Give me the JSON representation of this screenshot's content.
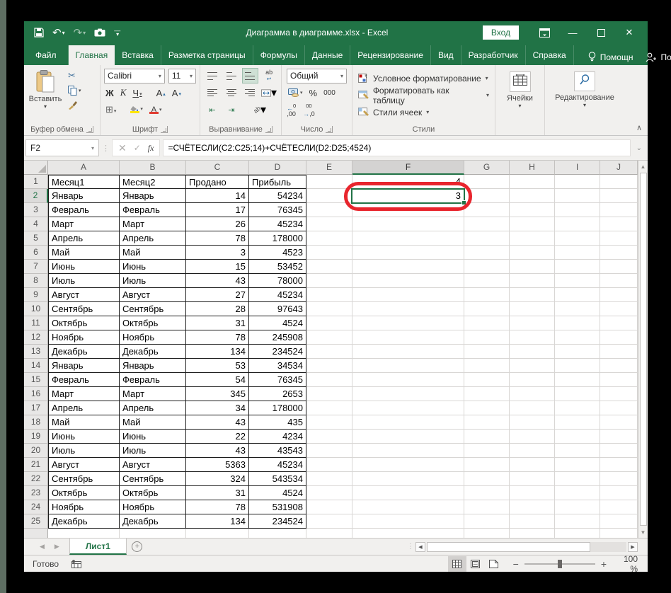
{
  "window": {
    "title": "Диаграмма в диаграмме.xlsx  -  Excel",
    "login_label": "Вход",
    "minimize": "—",
    "maximize": "❐",
    "close": "✕"
  },
  "tabs": {
    "file": "Файл",
    "home": "Главная",
    "insert": "Вставка",
    "layout": "Разметка страницы",
    "formulas": "Формулы",
    "data": "Данные",
    "review": "Рецензирование",
    "view": "Вид",
    "developer": "Разработчик",
    "help": "Справка",
    "assistant": "Помощн",
    "share": "Поделиться"
  },
  "ribbon": {
    "paste_label": "Вставить",
    "group_clipboard": "Буфер обмена",
    "group_font": "Шрифт",
    "group_align": "Выравнивание",
    "group_number": "Число",
    "group_styles": "Стили",
    "font_name": "Calibri",
    "font_size": "11",
    "number_format": "Общий",
    "style_conditional": "Условное форматирование",
    "style_table": "Форматировать как таблицу",
    "style_cells": "Стили ячеек",
    "cells_label": "Ячейки",
    "editing_label": "Редактирование"
  },
  "formula_bar": {
    "name_box": "F2",
    "formula": "=СЧЁТЕСЛИ(C2:C25;14)+СЧЁТЕСЛИ(D2:D25;4524)"
  },
  "sheet": {
    "columns": [
      "A",
      "B",
      "C",
      "D",
      "E",
      "F",
      "G",
      "H",
      "I",
      "J"
    ],
    "selected_column": "F",
    "selected_row": 2,
    "header_row": [
      "Месяц1",
      "Месяц2",
      "Продано",
      "Прибыль"
    ],
    "data_rows": [
      [
        "Январь",
        "Январь",
        "14",
        "54234"
      ],
      [
        "Февраль",
        "Февраль",
        "17",
        "76345"
      ],
      [
        "Март",
        "Март",
        "26",
        "45234"
      ],
      [
        "Апрель",
        "Апрель",
        "78",
        "178000"
      ],
      [
        "Май",
        "Май",
        "3",
        "4523"
      ],
      [
        "Июнь",
        "Июнь",
        "15",
        "53452"
      ],
      [
        "Июль",
        "Июль",
        "43",
        "78000"
      ],
      [
        "Август",
        "Август",
        "27",
        "45234"
      ],
      [
        "Сентябрь",
        "Сентябрь",
        "28",
        "97643"
      ],
      [
        "Октябрь",
        "Октябрь",
        "31",
        "4524"
      ],
      [
        "Ноябрь",
        "Ноябрь",
        "78",
        "245908"
      ],
      [
        "Декабрь",
        "Декабрь",
        "134",
        "234524"
      ],
      [
        "Январь",
        "Январь",
        "53",
        "34534"
      ],
      [
        "Февраль",
        "Февраль",
        "54",
        "76345"
      ],
      [
        "Март",
        "Март",
        "345",
        "2653"
      ],
      [
        "Апрель",
        "Апрель",
        "34",
        "178000"
      ],
      [
        "Май",
        "Май",
        "43",
        "435"
      ],
      [
        "Июнь",
        "Июнь",
        "22",
        "4234"
      ],
      [
        "Июль",
        "Июль",
        "43",
        "43543"
      ],
      [
        "Август",
        "Август",
        "5363",
        "45234"
      ],
      [
        "Сентябрь",
        "Сентябрь",
        "324",
        "543534"
      ],
      [
        "Октябрь",
        "Октябрь",
        "31",
        "4524"
      ],
      [
        "Ноябрь",
        "Ноябрь",
        "78",
        "531908"
      ],
      [
        "Декабрь",
        "Декабрь",
        "134",
        "234524"
      ]
    ],
    "f_column": {
      "1": "4",
      "2": "3"
    }
  },
  "sheet_tabs": {
    "active": "Лист1"
  },
  "status_bar": {
    "ready": "Готово",
    "zoom": "100 %"
  },
  "colors": {
    "excel_green": "#217346",
    "annotation_red": "#e8252d",
    "fill_yellow": "#ffe600",
    "font_red": "#e03c31"
  },
  "icons": {
    "dropdown": "▾",
    "undo": "↶",
    "redo": "↷",
    "scissors": "✂",
    "bold": "Ж",
    "italic": "К",
    "underline": "Ч",
    "grow_font": "А",
    "shrink_font": "А",
    "caret_up": "▴",
    "caret_down": "▾",
    "borders": "⊞",
    "font_color": "А",
    "percent": "%",
    "thousands": "000",
    "wrap": "ab",
    "orient": "ab",
    "indent_dec": "⇤",
    "indent_inc": "⇥",
    "merge": "⇔",
    "cancel": "✕",
    "check": "✓",
    "fx": "fx",
    "dots": "⋮",
    "chevron_up": "∧",
    "chevron_down": "⌄",
    "up": "▲",
    "down": "▼",
    "left": "◀",
    "right": "▶",
    "plus": "+",
    "minus": "−",
    "dec_left": "←",
    "dec_right": "→",
    "dec_zeros": ",00",
    "dec_zero": ",0"
  }
}
